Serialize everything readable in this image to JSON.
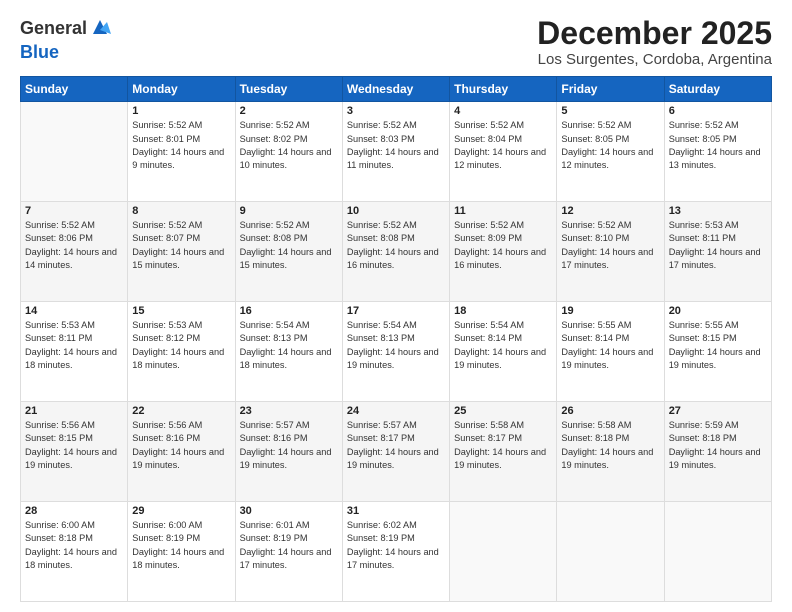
{
  "header": {
    "logo_general": "General",
    "logo_blue": "Blue",
    "month_title": "December 2025",
    "location": "Los Surgentes, Cordoba, Argentina"
  },
  "calendar": {
    "days_of_week": [
      "Sunday",
      "Monday",
      "Tuesday",
      "Wednesday",
      "Thursday",
      "Friday",
      "Saturday"
    ],
    "weeks": [
      [
        {
          "day": "",
          "sunrise": "",
          "sunset": "",
          "daylight": ""
        },
        {
          "day": "1",
          "sunrise": "Sunrise: 5:52 AM",
          "sunset": "Sunset: 8:01 PM",
          "daylight": "Daylight: 14 hours and 9 minutes."
        },
        {
          "day": "2",
          "sunrise": "Sunrise: 5:52 AM",
          "sunset": "Sunset: 8:02 PM",
          "daylight": "Daylight: 14 hours and 10 minutes."
        },
        {
          "day": "3",
          "sunrise": "Sunrise: 5:52 AM",
          "sunset": "Sunset: 8:03 PM",
          "daylight": "Daylight: 14 hours and 11 minutes."
        },
        {
          "day": "4",
          "sunrise": "Sunrise: 5:52 AM",
          "sunset": "Sunset: 8:04 PM",
          "daylight": "Daylight: 14 hours and 12 minutes."
        },
        {
          "day": "5",
          "sunrise": "Sunrise: 5:52 AM",
          "sunset": "Sunset: 8:05 PM",
          "daylight": "Daylight: 14 hours and 12 minutes."
        },
        {
          "day": "6",
          "sunrise": "Sunrise: 5:52 AM",
          "sunset": "Sunset: 8:05 PM",
          "daylight": "Daylight: 14 hours and 13 minutes."
        }
      ],
      [
        {
          "day": "7",
          "sunrise": "Sunrise: 5:52 AM",
          "sunset": "Sunset: 8:06 PM",
          "daylight": "Daylight: 14 hours and 14 minutes."
        },
        {
          "day": "8",
          "sunrise": "Sunrise: 5:52 AM",
          "sunset": "Sunset: 8:07 PM",
          "daylight": "Daylight: 14 hours and 15 minutes."
        },
        {
          "day": "9",
          "sunrise": "Sunrise: 5:52 AM",
          "sunset": "Sunset: 8:08 PM",
          "daylight": "Daylight: 14 hours and 15 minutes."
        },
        {
          "day": "10",
          "sunrise": "Sunrise: 5:52 AM",
          "sunset": "Sunset: 8:08 PM",
          "daylight": "Daylight: 14 hours and 16 minutes."
        },
        {
          "day": "11",
          "sunrise": "Sunrise: 5:52 AM",
          "sunset": "Sunset: 8:09 PM",
          "daylight": "Daylight: 14 hours and 16 minutes."
        },
        {
          "day": "12",
          "sunrise": "Sunrise: 5:52 AM",
          "sunset": "Sunset: 8:10 PM",
          "daylight": "Daylight: 14 hours and 17 minutes."
        },
        {
          "day": "13",
          "sunrise": "Sunrise: 5:53 AM",
          "sunset": "Sunset: 8:11 PM",
          "daylight": "Daylight: 14 hours and 17 minutes."
        }
      ],
      [
        {
          "day": "14",
          "sunrise": "Sunrise: 5:53 AM",
          "sunset": "Sunset: 8:11 PM",
          "daylight": "Daylight: 14 hours and 18 minutes."
        },
        {
          "day": "15",
          "sunrise": "Sunrise: 5:53 AM",
          "sunset": "Sunset: 8:12 PM",
          "daylight": "Daylight: 14 hours and 18 minutes."
        },
        {
          "day": "16",
          "sunrise": "Sunrise: 5:54 AM",
          "sunset": "Sunset: 8:13 PM",
          "daylight": "Daylight: 14 hours and 18 minutes."
        },
        {
          "day": "17",
          "sunrise": "Sunrise: 5:54 AM",
          "sunset": "Sunset: 8:13 PM",
          "daylight": "Daylight: 14 hours and 19 minutes."
        },
        {
          "day": "18",
          "sunrise": "Sunrise: 5:54 AM",
          "sunset": "Sunset: 8:14 PM",
          "daylight": "Daylight: 14 hours and 19 minutes."
        },
        {
          "day": "19",
          "sunrise": "Sunrise: 5:55 AM",
          "sunset": "Sunset: 8:14 PM",
          "daylight": "Daylight: 14 hours and 19 minutes."
        },
        {
          "day": "20",
          "sunrise": "Sunrise: 5:55 AM",
          "sunset": "Sunset: 8:15 PM",
          "daylight": "Daylight: 14 hours and 19 minutes."
        }
      ],
      [
        {
          "day": "21",
          "sunrise": "Sunrise: 5:56 AM",
          "sunset": "Sunset: 8:15 PM",
          "daylight": "Daylight: 14 hours and 19 minutes."
        },
        {
          "day": "22",
          "sunrise": "Sunrise: 5:56 AM",
          "sunset": "Sunset: 8:16 PM",
          "daylight": "Daylight: 14 hours and 19 minutes."
        },
        {
          "day": "23",
          "sunrise": "Sunrise: 5:57 AM",
          "sunset": "Sunset: 8:16 PM",
          "daylight": "Daylight: 14 hours and 19 minutes."
        },
        {
          "day": "24",
          "sunrise": "Sunrise: 5:57 AM",
          "sunset": "Sunset: 8:17 PM",
          "daylight": "Daylight: 14 hours and 19 minutes."
        },
        {
          "day": "25",
          "sunrise": "Sunrise: 5:58 AM",
          "sunset": "Sunset: 8:17 PM",
          "daylight": "Daylight: 14 hours and 19 minutes."
        },
        {
          "day": "26",
          "sunrise": "Sunrise: 5:58 AM",
          "sunset": "Sunset: 8:18 PM",
          "daylight": "Daylight: 14 hours and 19 minutes."
        },
        {
          "day": "27",
          "sunrise": "Sunrise: 5:59 AM",
          "sunset": "Sunset: 8:18 PM",
          "daylight": "Daylight: 14 hours and 19 minutes."
        }
      ],
      [
        {
          "day": "28",
          "sunrise": "Sunrise: 6:00 AM",
          "sunset": "Sunset: 8:18 PM",
          "daylight": "Daylight: 14 hours and 18 minutes."
        },
        {
          "day": "29",
          "sunrise": "Sunrise: 6:00 AM",
          "sunset": "Sunset: 8:19 PM",
          "daylight": "Daylight: 14 hours and 18 minutes."
        },
        {
          "day": "30",
          "sunrise": "Sunrise: 6:01 AM",
          "sunset": "Sunset: 8:19 PM",
          "daylight": "Daylight: 14 hours and 17 minutes."
        },
        {
          "day": "31",
          "sunrise": "Sunrise: 6:02 AM",
          "sunset": "Sunset: 8:19 PM",
          "daylight": "Daylight: 14 hours and 17 minutes."
        },
        {
          "day": "",
          "sunrise": "",
          "sunset": "",
          "daylight": ""
        },
        {
          "day": "",
          "sunrise": "",
          "sunset": "",
          "daylight": ""
        },
        {
          "day": "",
          "sunrise": "",
          "sunset": "",
          "daylight": ""
        }
      ]
    ]
  }
}
